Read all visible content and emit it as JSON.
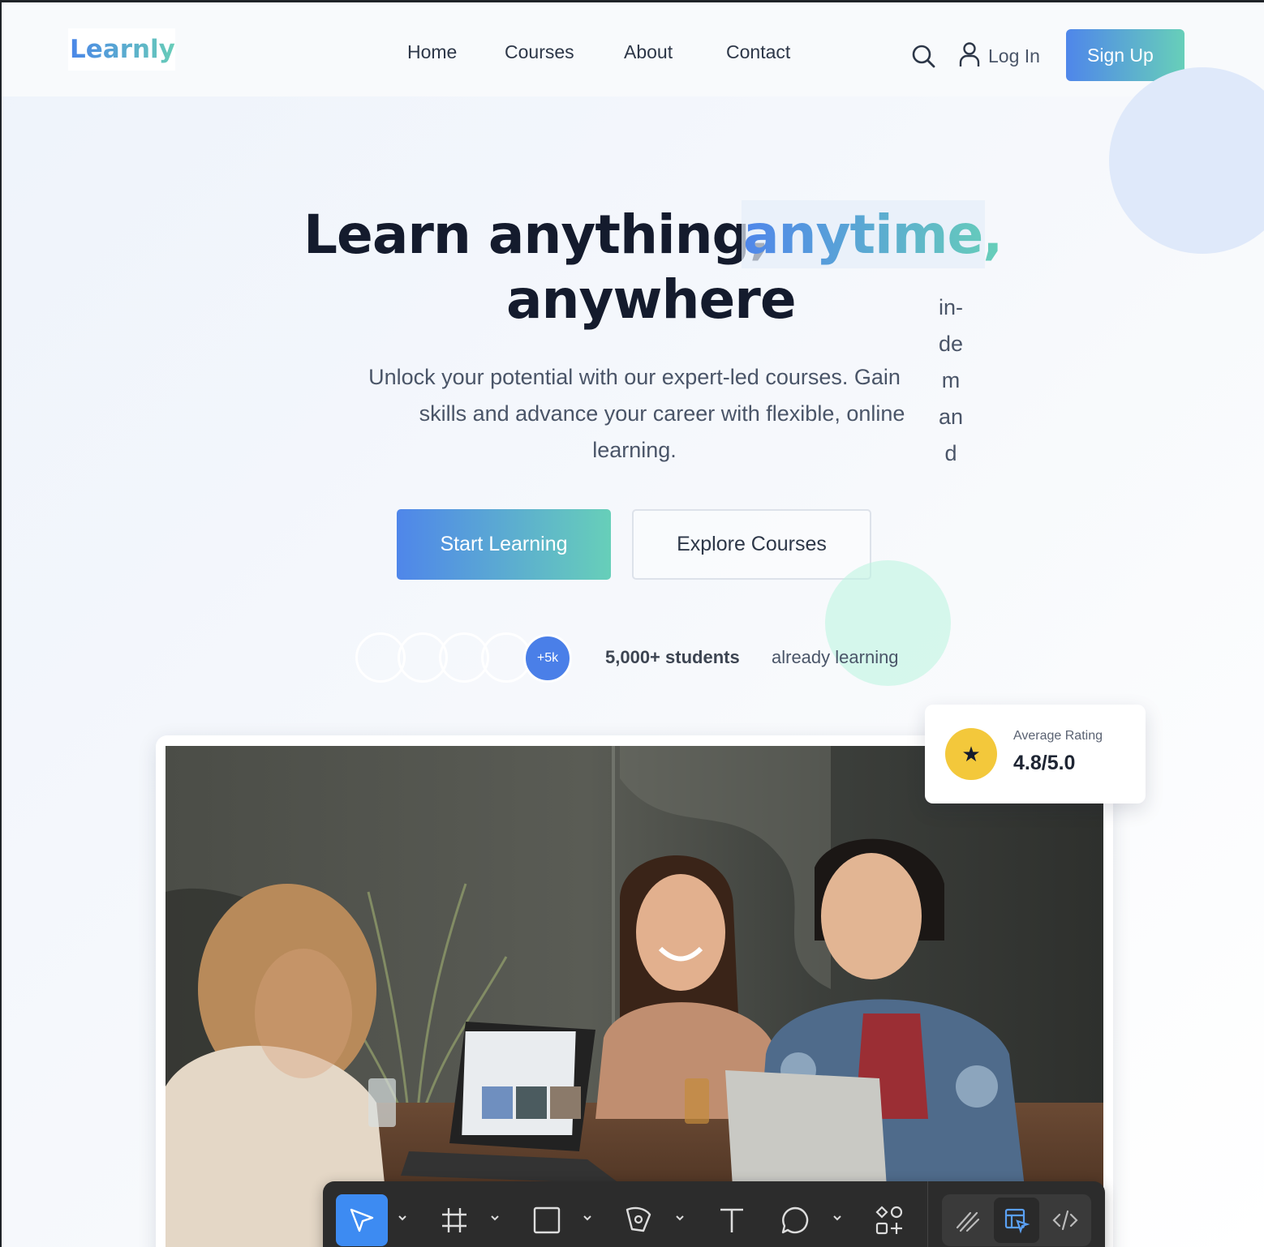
{
  "brand": {
    "logo": "Learnly"
  },
  "nav": {
    "links": [
      "Home",
      "Courses",
      "About",
      "Contact"
    ],
    "login_label": "Log In",
    "signup_label": "Sign Up"
  },
  "hero": {
    "title_part1": "Learn anything,",
    "title_accent": "anytime,",
    "title_part2": "anywhere",
    "vertical_fragments": [
      "in-",
      "de",
      "m",
      "an",
      "d"
    ],
    "subtitle_lines": [
      "Unlock your potential with our expert-led courses. Gain",
      "skills and advance your career with flexible, online",
      "learning."
    ],
    "cta_primary": "Start Learning",
    "cta_secondary": "Explore Courses"
  },
  "social_proof": {
    "badge": "+5k",
    "count_label": "5,000+ students",
    "suffix": "already learning"
  },
  "rating": {
    "label": "Average Rating",
    "value": "4.8/5.0",
    "icon": "star-icon"
  },
  "toolbar": {
    "tools": [
      "move-tool",
      "frame-tool",
      "rectangle-tool",
      "pen-tool",
      "text-tool",
      "comment-tool",
      "components-tool"
    ],
    "extras": [
      "draw-mode",
      "dev-inspect",
      "code-view"
    ],
    "active_tool": "move-tool"
  },
  "colors": {
    "accent_start": "#4f86ea",
    "accent_end": "#67cfb9",
    "heading": "#141b2d",
    "star": "#f3c83b",
    "toolbar_bg": "#2c2c2c",
    "toolbar_active": "#3d8bf2"
  }
}
